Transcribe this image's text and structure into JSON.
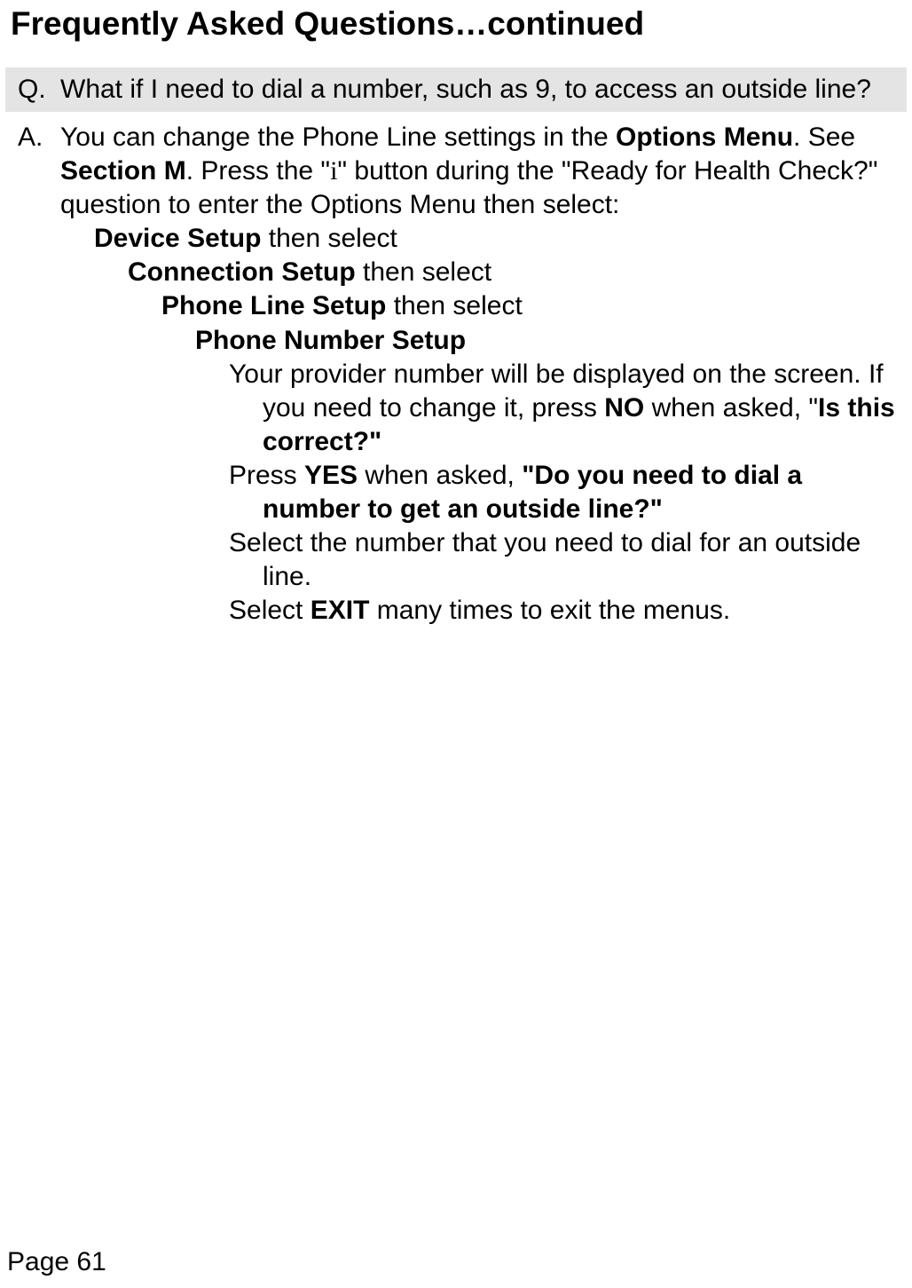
{
  "title": "Frequently Asked Questions…continued",
  "q": {
    "label": "Q.",
    "text": "What if I need to dial a number, such as 9, to access an outside line?"
  },
  "a": {
    "label": "A.",
    "p1_before": "You can change the Phone Line settings in the ",
    "p1_b1": "Options Menu",
    "p1_mid1": ". See ",
    "p1_b2": "Section M",
    "p1_mid2": ". Press the \"",
    "p1_i": "i",
    "p1_mid3": "\" button during the \"Ready for Health Check?\" question to enter the Options Menu then select:",
    "lvl1_b": "Device Setup",
    "lvl1_after": " then select",
    "lvl2_b": "Connection Setup",
    "lvl2_after": " then select",
    "lvl3_b": "Phone Line Setup",
    "lvl3_after": " then select",
    "lvl4_b": "Phone Number Setup",
    "s1_before": "Your provider number will be displayed on the screen.  If you need to change it, press ",
    "s1_b1": "NO",
    "s1_mid": " when asked, \"",
    "s1_b2": "Is this correct?\"",
    "s2_before": "Press ",
    "s2_b1": "YES",
    "s2_mid": " when asked, ",
    "s2_b2": "\"Do you need to dial a number to get an outside line?\"",
    "s3": "Select the number that you need to dial for an outside line.",
    "s4_before": "Select ",
    "s4_b": "EXIT",
    "s4_after": " many times to exit the menus."
  },
  "pageNumber": "Page 61"
}
